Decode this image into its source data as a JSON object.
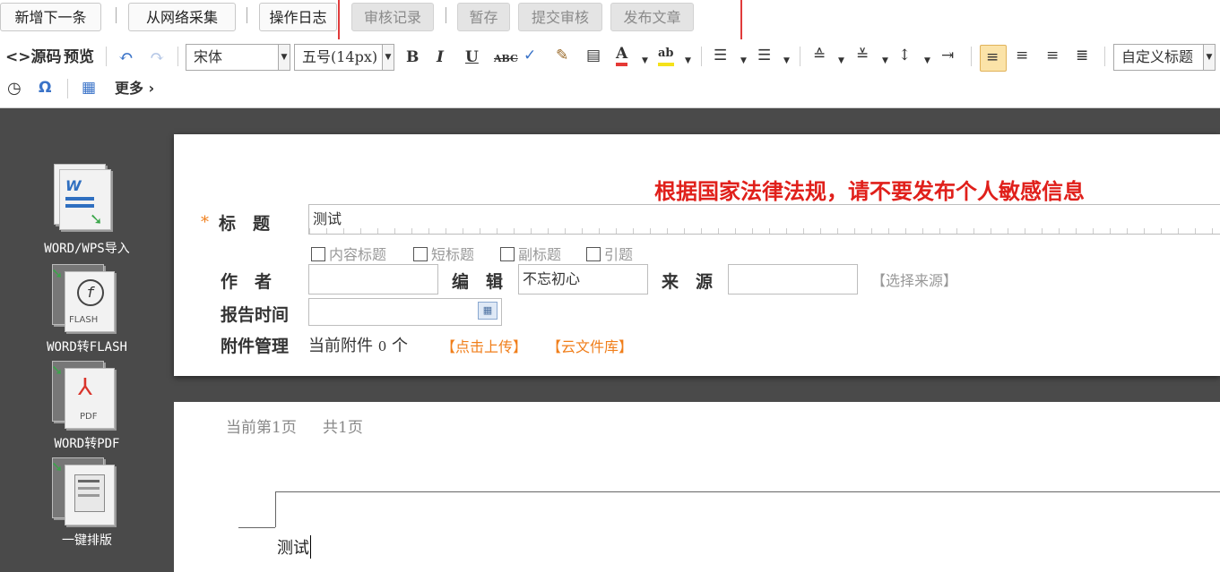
{
  "topbar": {
    "buttons": [
      {
        "label": "新增下一条",
        "disabled": false
      },
      {
        "label": "从网络采集",
        "disabled": false
      },
      {
        "label": "操作日志",
        "disabled": false
      },
      {
        "label": "审核记录",
        "disabled": true
      },
      {
        "label": "暂存",
        "disabled": true
      },
      {
        "label": "提交审核",
        "disabled": true
      },
      {
        "label": "发布文章",
        "disabled": true
      }
    ],
    "separator": "|"
  },
  "editor_toolbar": {
    "source_label": "<>源码",
    "preview_label": "预览",
    "font_family": "宋体",
    "font_size": "五号(14px)",
    "bold": "B",
    "italic": "I",
    "underline": "U",
    "strike": "ABC",
    "font_color_glyph": "A",
    "highlight_glyph": "ab",
    "custom_heading": "自定义标题",
    "more_label": "更多 ›",
    "omega": "Ω",
    "accent_color": "#e53935",
    "active_color": "#fbe3a8"
  },
  "left_tools": [
    {
      "label": "WORD/WPS导入"
    },
    {
      "label": "WORD转FLASH"
    },
    {
      "label": "WORD转PDF"
    },
    {
      "label": "一键排版"
    }
  ],
  "form": {
    "notice": "根据国家法律法规，请不要发布个人敏感信息",
    "required_mark": "*",
    "title_label": "标　题",
    "title_value": "测试",
    "title_options": [
      "内容标题",
      "短标题",
      "副标题",
      "引题"
    ],
    "author_label": "作　者",
    "author_value": "",
    "editor_label": "编　辑",
    "editor_value": "不忘初心",
    "source_label": "来　源",
    "source_value": "",
    "choose_source": "【选择来源】",
    "report_time_label": "报告时间",
    "report_time_value": "",
    "attachment_label": "附件管理",
    "attachment_text": "当前附件",
    "attachment_count": "0",
    "attachment_unit": "个",
    "upload_link": "【点击上传】",
    "cloud_link": "【云文件库】",
    "notice_color": "#e0201b",
    "link_color": "#f07e1a"
  },
  "page": {
    "page_info": "当前第1页",
    "total_info": "共1页",
    "content": "测试"
  }
}
